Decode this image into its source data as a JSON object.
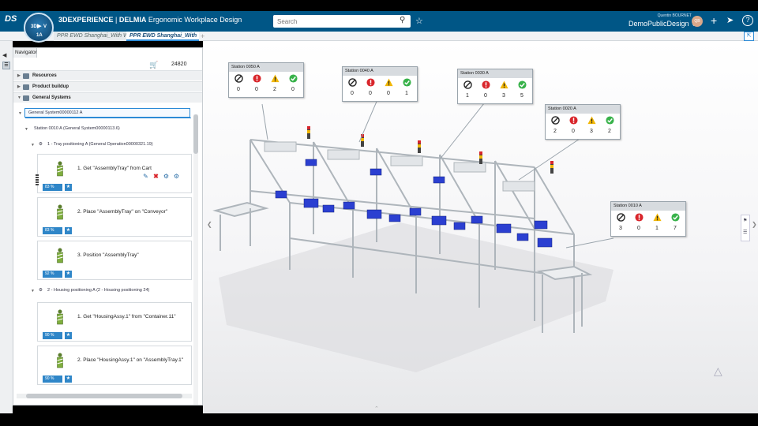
{
  "app": {
    "brand": "3DEXPERIENCE",
    "product": "DELMIA",
    "app_name": "Ergonomic Workplace Design",
    "search_placeholder": "Search",
    "user_name": "Quentin BOURNET",
    "collab_space": "DemoPublicDesign",
    "avatar_initials": "QB",
    "compass_letters": [
      "3D",
      "V",
      "1A",
      "▶"
    ]
  },
  "tabs": [
    {
      "label": "PPR EWD Shanghai_With W"
    },
    {
      "label": "PPR EWD Shanghai_With"
    }
  ],
  "navigator": {
    "title": "Navigator",
    "cart_count": "24820",
    "sections": [
      {
        "label": "Resources"
      },
      {
        "label": "Product buildup"
      },
      {
        "label": "General Systems"
      }
    ],
    "tree": {
      "root": "General System00000112 A",
      "station": "Station 0010 A (General System00000113.6)",
      "op1": "1 - Tray positioning A (General Operation00000321.19)",
      "op2": "2 - Housing positioning A (2 - Housing positioning 24)"
    },
    "cards": [
      {
        "title": "1. Get \"AssemblyTray\" from Cart",
        "pct": "83 %"
      },
      {
        "title": "2. Place \"AssemblyTray\" on \"Conveyor\"",
        "pct": "83 %"
      },
      {
        "title": "3. Position \"AssemblyTray\"",
        "pct": "92 %"
      },
      {
        "title": "1. Get \"HousingAssy.1\" from \"Container.11\"",
        "pct": "90 %"
      },
      {
        "title": "2. Place \"HousingAssy.1\" on \"AssemblyTray.1\"",
        "pct": "90 %"
      }
    ]
  },
  "stations": [
    {
      "name": "Station 0050 A",
      "counts": [
        "0",
        "0",
        "2",
        "0"
      ]
    },
    {
      "name": "Station 0040 A",
      "counts": [
        "0",
        "0",
        "0",
        "1"
      ]
    },
    {
      "name": "Station 0030 A",
      "counts": [
        "1",
        "0",
        "3",
        "5"
      ]
    },
    {
      "name": "Station 0020 A",
      "counts": [
        "2",
        "0",
        "3",
        "2"
      ]
    },
    {
      "name": "Station 0010 A",
      "counts": [
        "3",
        "0",
        "1",
        "7"
      ]
    }
  ],
  "colors": {
    "topbar": "#005686",
    "accent": "#2b8ad6",
    "badge": "#2f86c8",
    "error": "#d9262c",
    "warning": "#f2b705",
    "ok": "#38b24a",
    "rack": "#c9ced3",
    "bin": "#2b3fd1"
  }
}
